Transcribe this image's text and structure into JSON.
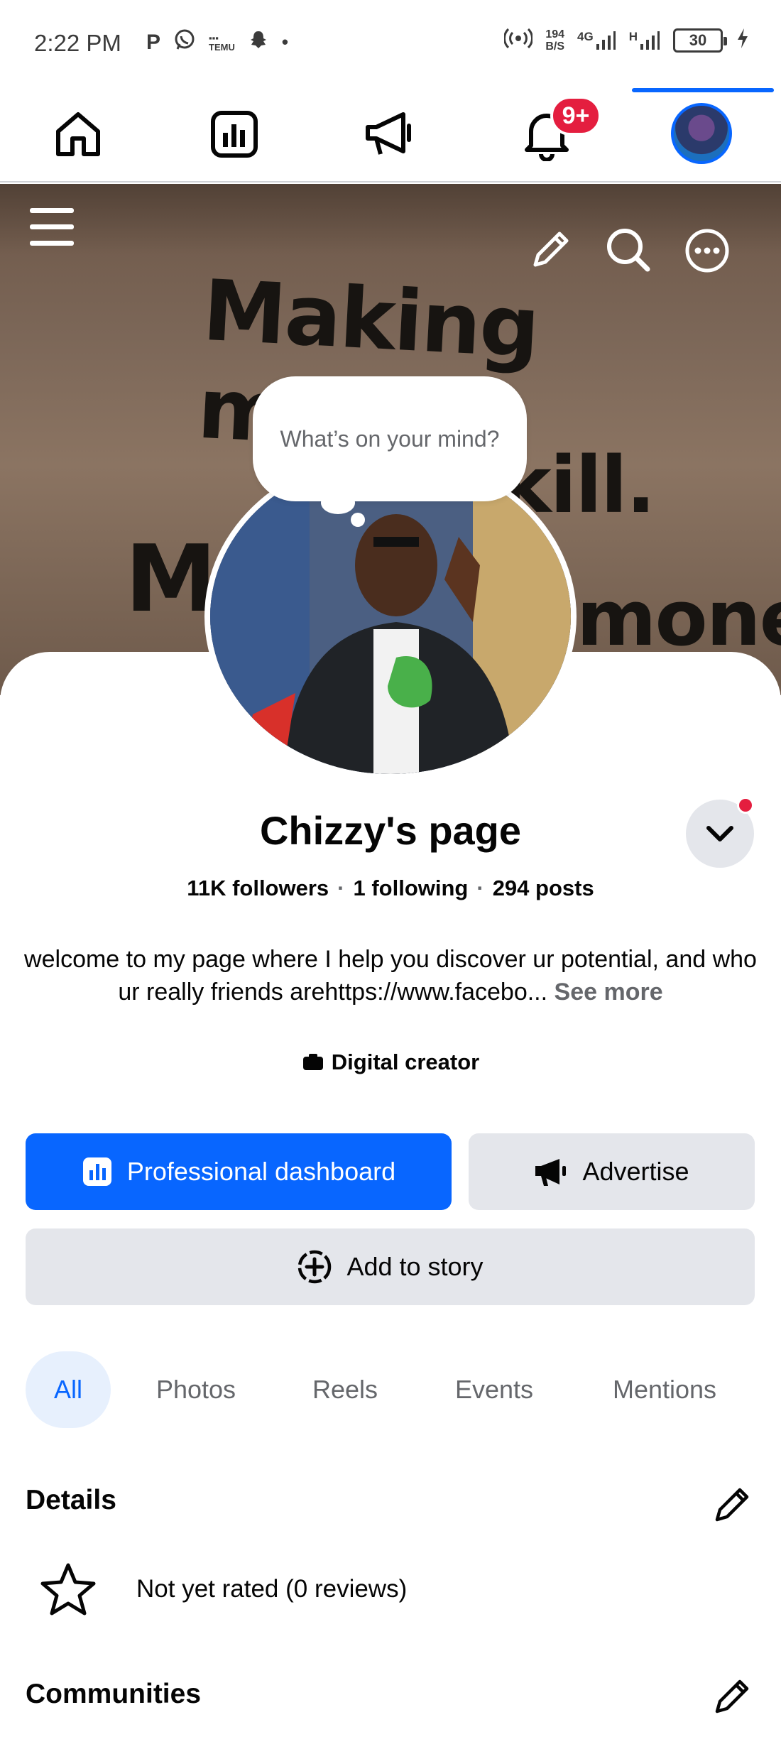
{
  "status_bar": {
    "time": "2:22 PM",
    "left_icons": [
      "p-icon",
      "whatsapp-icon",
      "temu-icon",
      "snapchat-icon",
      "dot-icon"
    ],
    "speed_value": "194",
    "speed_unit": "B/S",
    "network": "4G",
    "network2": "H",
    "battery": "30"
  },
  "top_nav": {
    "items": [
      "home-icon",
      "dashboard-icon",
      "megaphone-icon",
      "bell-icon",
      "profile-avatar"
    ],
    "notification_badge": "9+",
    "active": "profile"
  },
  "cover": {
    "wall_text_line1": "Making money",
    "wall_text_line2": "skill.",
    "wall_text_line3_left": "M",
    "wall_text_line3_right": "money"
  },
  "status_prompt": "What’s on your mind?",
  "profile": {
    "name": "Chizzy's page",
    "followers": "11K followers",
    "following": "1 following",
    "posts": "294 posts",
    "bio": "welcome to my page where I help you discover ur potential, and who ur really friends arehttps://www.facebo...",
    "see_more": "See more",
    "category": "Digital creator"
  },
  "buttons": {
    "professional_dashboard": "Professional dashboard",
    "advertise": "Advertise",
    "add_to_story": "Add to story"
  },
  "tabs": [
    "All",
    "Photos",
    "Reels",
    "Events",
    "Mentions"
  ],
  "details": {
    "title": "Details",
    "rating": "Not yet rated (0 reviews)"
  },
  "communities": {
    "title": "Communities"
  },
  "colors": {
    "accent": "#0866ff",
    "badge": "#e41e3f",
    "secondary_button": "#e4e6eb",
    "muted_text": "#65676b"
  }
}
